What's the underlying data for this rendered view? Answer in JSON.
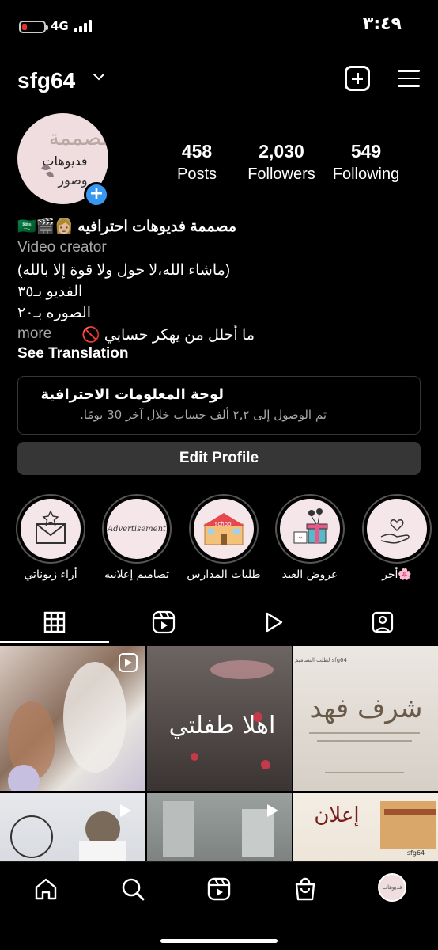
{
  "status_bar": {
    "time": "٣:٤٩",
    "network": "4G"
  },
  "header": {
    "username": "sfg64",
    "icons": [
      "chevron-down-icon",
      "new-post-icon",
      "menu-icon"
    ]
  },
  "avatar": {
    "text_line1": "مصممة",
    "text_line2": "فديوهات",
    "text_line3": "وصور"
  },
  "stats": [
    {
      "value": "458",
      "label": "Posts"
    },
    {
      "value": "2,030",
      "label": "Followers"
    },
    {
      "value": "549",
      "label": "Following"
    }
  ],
  "bio": {
    "name": "مصممة فديوهات احترافيه 👩🏼🎬🇸🇦",
    "category": "Video creator",
    "line1": "(ماشاء الله،لا حول ولا قوة إلا بالله)",
    "line2": "الفديو بـ٣٥",
    "line3": "الصوره بـ٢٠",
    "line4": "ما أحلل من يهكر حسابي 🚫",
    "more": "more",
    "see_translation": "See Translation"
  },
  "dashboard": {
    "title": "لوحة المعلومات الاحترافية",
    "subtitle": "تم الوصول إلى ٢,٢ ألف حساب خلال آخر 30 يومًا."
  },
  "edit_profile": "Edit Profile",
  "highlights": [
    {
      "label": "أراء زبوناتي",
      "icon": "envelope-star-icon"
    },
    {
      "label": "تصاميم إعلانيه",
      "icon": "advertisement-icon",
      "inner_text": "Advertisement"
    },
    {
      "label": "طلبات المدارس",
      "icon": "school-icon",
      "inner_text": "school"
    },
    {
      "label": "عروض العيد",
      "icon": "gift-icon"
    },
    {
      "label": "أجر🌸",
      "icon": "hand-heart-icon"
    }
  ],
  "tabs": [
    "grid-icon",
    "reels-icon",
    "video-icon",
    "tagged-icon"
  ],
  "posts": [
    {
      "caption": "",
      "type": "reel"
    },
    {
      "caption": "اهلا طفلتي",
      "type": "image"
    },
    {
      "caption": "شرف فهد",
      "type": "image",
      "small_text": "لطلب التصاميم sfg64"
    },
    {
      "caption": "",
      "type": "video"
    },
    {
      "caption": "",
      "type": "video"
    },
    {
      "caption": "إعلان",
      "type": "image",
      "small_text": "sfg64"
    }
  ],
  "bottom_nav": [
    "home-icon",
    "search-icon",
    "reels-icon",
    "shop-icon",
    "profile-avatar"
  ],
  "colors": {
    "accent_blue": "#3897f0",
    "background": "#000000",
    "secondary_text": "#a8a8a8",
    "button_bg": "#363636",
    "avatar_bg": "#efdde0"
  }
}
